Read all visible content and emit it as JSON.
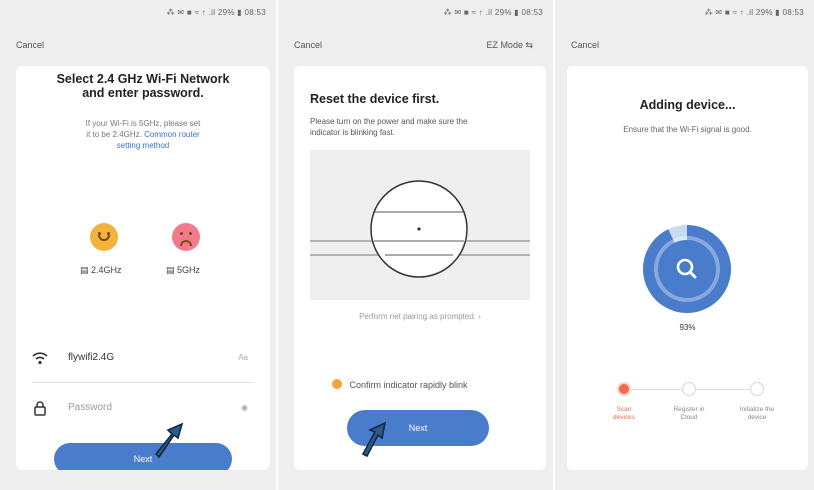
{
  "screens": [
    {
      "status": "⁂ ✉ ■ ≈ ↑ .il 29% ▮ 08:53",
      "cancel": "Cancel",
      "title_line1": "Select 2.4 GHz Wi-Fi Network",
      "title_line2": "and enter password.",
      "hint_line1": "If your Wi-Fi is 5GHz, please set",
      "hint_line2_prefix": "it to be 2.4GHz.",
      "hint_link_line1": "Common router",
      "hint_link_line2": "setting method",
      "band_good": "2.4GHz",
      "band_bad": "5GHz",
      "wifi_name": "flywifi2.4G",
      "wifi_hint": "Aa",
      "password_placeholder": "Password",
      "password_hint": "◉",
      "next": "Next"
    },
    {
      "status": "⁂ ✉ ■ ≈ ↑ .il 29% ▮ 08:53",
      "cancel": "Cancel",
      "ez_mode": "EZ Mode ⇆",
      "title": "Reset the device first.",
      "desc_line1": "Please turn on the power and make sure the",
      "desc_line2": "indicator is blinking fast.",
      "pairing_link": "Perform net pairing as prompted. ›",
      "confirm": "Confirm indicator rapidly blink",
      "next": "Next"
    },
    {
      "status": "⁂ ✉ ■ ≈ ↑ .il 29% ▮ 08:53",
      "cancel": "Cancel",
      "title": "Adding device...",
      "desc": "Ensure that the Wi-Fi signal is good.",
      "progress_label": "93%",
      "progress_value": 0.93,
      "steps": [
        {
          "line1": "Scan",
          "line2": "devices"
        },
        {
          "line1": "Register in",
          "line2": "Cloud"
        },
        {
          "line1": "Initialize the",
          "line2": "device"
        }
      ]
    }
  ],
  "colors": {
    "accent": "#4a7ccc",
    "link": "#3b6fd1",
    "happy": "#f4b33f",
    "sad": "#f27a8a",
    "check": "#f1a53a",
    "step_active": "#f06a4c"
  }
}
